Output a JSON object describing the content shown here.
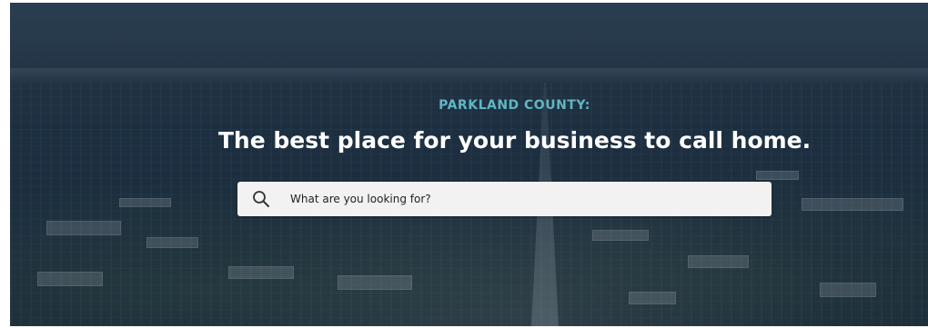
{
  "hero": {
    "eyebrow": "PARKLAND COUNTY:",
    "headline": "The best place for your business to call home.",
    "background_image": "aerial-industrial-park-photo"
  },
  "search": {
    "icon": "search-icon",
    "placeholder": "What are you looking for?",
    "value": ""
  },
  "colors": {
    "eyebrow": "#5fb6c2",
    "headline": "#ffffff",
    "search_bg": "#f2f2f2",
    "overlay": "#1f3245"
  }
}
